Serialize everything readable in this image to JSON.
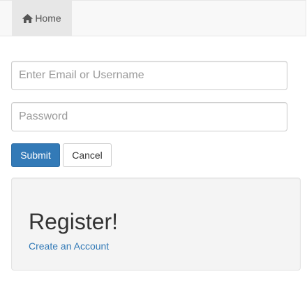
{
  "navbar": {
    "home_label": "Home",
    "home_icon": "home-icon"
  },
  "form": {
    "email_placeholder": "Enter Email or Username",
    "password_placeholder": "Password",
    "submit_label": "Submit",
    "cancel_label": "Cancel"
  },
  "register": {
    "heading": "Register!",
    "link_label": "Create an Account"
  },
  "colors": {
    "primary": "#337ab7",
    "navbar_bg": "#f8f8f8",
    "active_nav_bg": "#e7e7e7",
    "well_bg": "#f4f4f4"
  }
}
